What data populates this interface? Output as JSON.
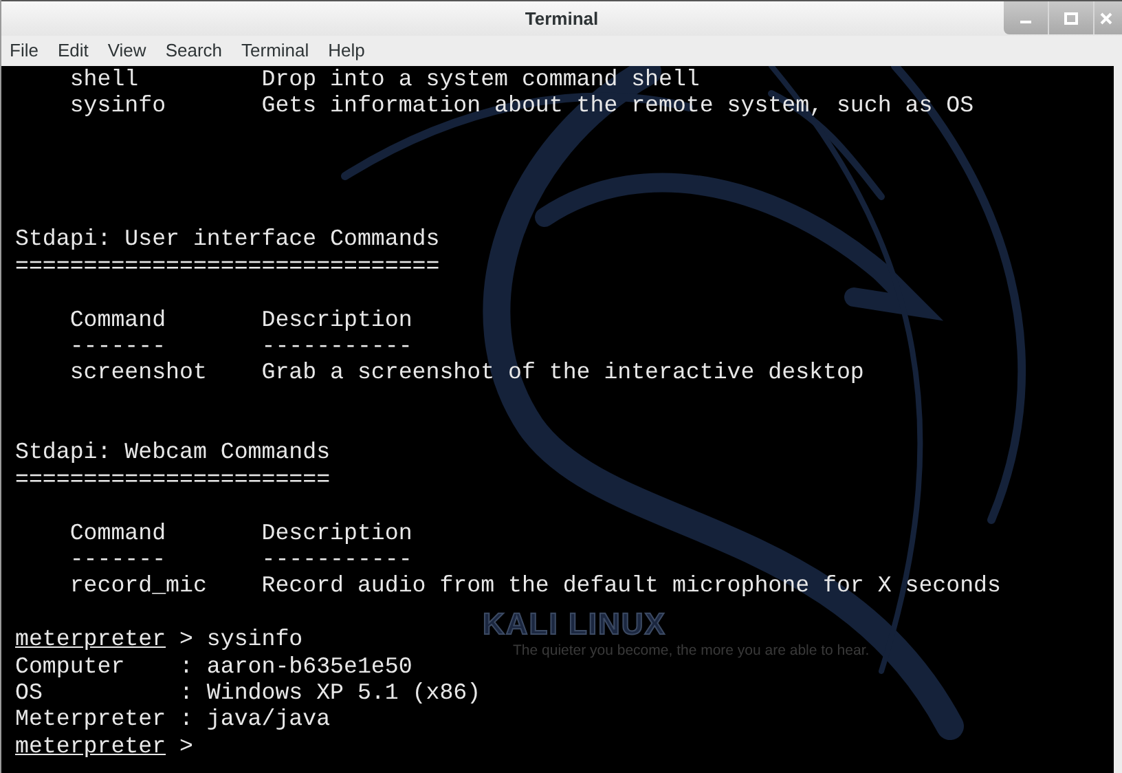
{
  "window": {
    "title": "Terminal"
  },
  "menu": [
    "File",
    "Edit",
    "View",
    "Search",
    "Terminal",
    "Help"
  ],
  "wallpaper": {
    "logo": "KALI LINUX",
    "tagline": "The quieter you become, the more you are able to hear."
  },
  "lines": [
    {
      "kind": "text",
      "text": "    shell         Drop into a system command shell"
    },
    {
      "kind": "text",
      "text": "    sysinfo       Gets information about the remote system, such as OS"
    },
    {
      "kind": "blank"
    },
    {
      "kind": "blank"
    },
    {
      "kind": "blank"
    },
    {
      "kind": "blank"
    },
    {
      "kind": "text",
      "text": "Stdapi: User interface Commands"
    },
    {
      "kind": "text",
      "text": "==============================="
    },
    {
      "kind": "blank"
    },
    {
      "kind": "text",
      "text": "    Command       Description"
    },
    {
      "kind": "text",
      "text": "    -------       -----------"
    },
    {
      "kind": "text",
      "text": "    screenshot    Grab a screenshot of the interactive desktop"
    },
    {
      "kind": "blank"
    },
    {
      "kind": "blank"
    },
    {
      "kind": "text",
      "text": "Stdapi: Webcam Commands"
    },
    {
      "kind": "text",
      "text": "======================="
    },
    {
      "kind": "blank"
    },
    {
      "kind": "text",
      "text": "    Command       Description"
    },
    {
      "kind": "text",
      "text": "    -------       -----------"
    },
    {
      "kind": "text",
      "text": "    record_mic    Record audio from the default microphone for X seconds"
    },
    {
      "kind": "blank"
    },
    {
      "kind": "prompt",
      "prompt": "meterpreter",
      "text": " > sysinfo"
    },
    {
      "kind": "text",
      "text": "Computer    : aaron-b635e1e50"
    },
    {
      "kind": "text",
      "text": "OS          : Windows XP 5.1 (x86)"
    },
    {
      "kind": "text",
      "text": "Meterpreter : java/java"
    },
    {
      "kind": "prompt",
      "prompt": "meterpreter",
      "text": " >"
    }
  ]
}
